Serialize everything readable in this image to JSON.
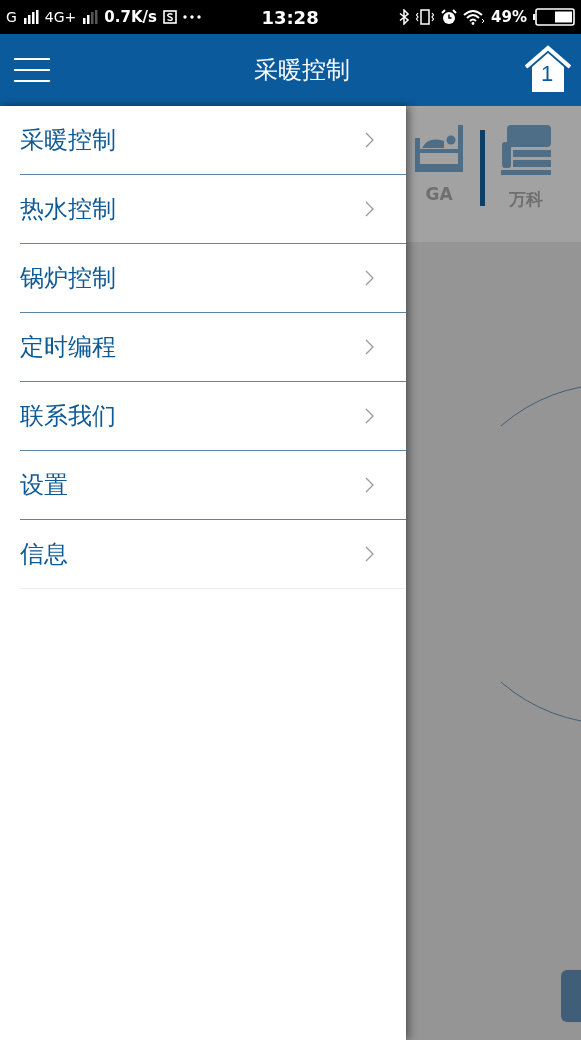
{
  "status_bar": {
    "carrier": "G",
    "network": "4G+",
    "speed": "0.7K/s",
    "time": "13:28",
    "battery": "49%"
  },
  "header": {
    "title": "采暖控制",
    "home_badge": "1"
  },
  "drawer": {
    "items": [
      {
        "label": "采暖控制"
      },
      {
        "label": "热水控制"
      },
      {
        "label": "锅炉控制"
      },
      {
        "label": "定时编程"
      },
      {
        "label": "联系我们"
      },
      {
        "label": "设置"
      },
      {
        "label": "信息"
      }
    ]
  },
  "rooms": [
    {
      "kind": "bed",
      "label": "GA"
    },
    {
      "kind": "sofa",
      "label": "万科"
    }
  ]
}
